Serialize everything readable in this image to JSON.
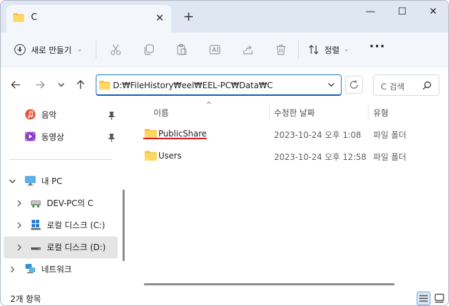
{
  "tab": {
    "title": "C",
    "close_glyph": "✕",
    "new_tab_glyph": "+"
  },
  "window_controls": {
    "minimize": "—",
    "maximize": "☐",
    "close": "✕"
  },
  "toolbar": {
    "new_label": "새로 만들기",
    "sort_label": "정렬",
    "more_label": "···",
    "icons": [
      "cut-icon",
      "copy-icon",
      "paste-icon",
      "rename-icon",
      "share-icon",
      "delete-icon"
    ]
  },
  "navigation": {
    "address": "D:₩FileHistory₩eel₩EEL-PC₩Data₩C",
    "search_placeholder": "C 검색"
  },
  "sidebar": {
    "quick_access": [
      {
        "label": "음악",
        "icon": "music-icon",
        "pinned": true
      },
      {
        "label": "동영상",
        "icon": "video-icon",
        "pinned": true
      }
    ],
    "this_pc": {
      "label": "내 PC",
      "expanded": true
    },
    "drives": [
      {
        "label": "DEV-PC의 C",
        "icon": "network-drive-icon"
      },
      {
        "label": "로컬 디스크 (C:)",
        "icon": "windows-drive-icon"
      },
      {
        "label": "로컬 디스크 (D:)",
        "icon": "drive-icon",
        "selected": true
      }
    ],
    "network": {
      "label": "네트워크"
    }
  },
  "columns": {
    "name": "이름",
    "date": "수정한 날짜",
    "type": "유형"
  },
  "files": [
    {
      "name": "PublicShare",
      "date": "2023-10-24 오후 1:08",
      "type": "파일 폴더",
      "highlighted": true
    },
    {
      "name": "Users",
      "date": "2023-10-24 오후 12:58",
      "type": "파일 폴더"
    }
  ],
  "status": {
    "item_count": "2개 항목"
  },
  "colors": {
    "accent": "#0b5cad",
    "folder": "#f6c443",
    "highlight_underline": "#d7191f",
    "titlebar": "#dfe7f2"
  }
}
